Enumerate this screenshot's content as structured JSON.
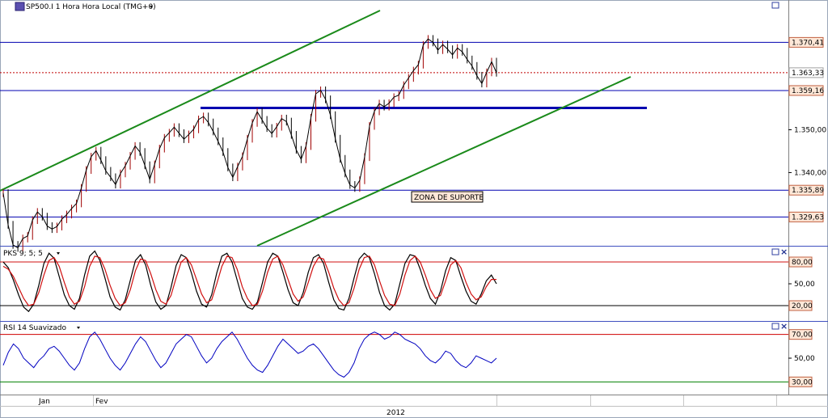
{
  "title": "SP500.I 1 Hora Hora Local (TMG+0)",
  "colors": {
    "price": "#000000",
    "candle_up": "#a00000",
    "hline": "#0000b0",
    "trend": "#1a8a1a",
    "dotted": "#c00000",
    "stoch_k": "#000000",
    "stoch_d": "#d01010",
    "rsi": "#0000c0",
    "rsi_upper": "#d00000",
    "rsi_lower": "#008000",
    "label_bg": "#ffe8d8",
    "label_border": "#c06040"
  },
  "icons": {
    "symbol": "chart-symbol-icon",
    "dropdown": "chevron-down-icon",
    "maximize": "maximize-icon",
    "close": "close-icon"
  },
  "chart_data": [
    {
      "type": "line",
      "panel": "price",
      "title": "SP500.I 1 Hora Hora Local (TMG+0)",
      "ylim": [
        1322.9,
        1380.3
      ],
      "y_ticks": [
        "1.340,00",
        "1.350,00"
      ],
      "price_series": [
        1335.2,
        1327.8,
        1323.1,
        1322.4,
        1324.6,
        1325.2,
        1328.9,
        1330.8,
        1329.7,
        1327.5,
        1326.8,
        1327.4,
        1329.1,
        1330.2,
        1331.6,
        1332.8,
        1336.4,
        1340.6,
        1343.7,
        1345.1,
        1342.9,
        1340.4,
        1338.9,
        1337.2,
        1339.8,
        1341.6,
        1343.9,
        1346.2,
        1344.8,
        1341.7,
        1338.4,
        1341.9,
        1345.6,
        1348.1,
        1349.3,
        1350.6,
        1349.2,
        1347.8,
        1348.9,
        1350.1,
        1352.4,
        1353.1,
        1351.7,
        1349.6,
        1347.3,
        1344.8,
        1341.2,
        1338.9,
        1341.4,
        1343.8,
        1347.9,
        1351.6,
        1354.2,
        1352.3,
        1350.4,
        1349.1,
        1350.7,
        1352.6,
        1351.9,
        1348.8,
        1345.3,
        1343.1,
        1346.2,
        1352.8,
        1358.4,
        1359.2,
        1357.1,
        1353.4,
        1347.9,
        1343.2,
        1339.8,
        1337.1,
        1336.4,
        1338.2,
        1343.6,
        1350.9,
        1354.3,
        1356.1,
        1355.4,
        1356.2,
        1357.6,
        1358.1,
        1360.4,
        1362.1,
        1363.8,
        1365.2,
        1369.8,
        1371.2,
        1370.4,
        1368.6,
        1369.9,
        1368.8,
        1367.5,
        1369.1,
        1368.2,
        1366.4,
        1364.9,
        1362.6,
        1360.8,
        1363.4,
        1365.9,
        1363.3
      ],
      "horizontal_lines": [
        {
          "value": 1370.41,
          "label": "1.370,41",
          "width": 1
        },
        {
          "value": 1359.16,
          "label": "1.359,16",
          "width": 1
        },
        {
          "value": 1335.89,
          "label": "1.335,89",
          "width": 1
        },
        {
          "value": 1329.63,
          "label": "1.329,63",
          "width": 1
        },
        {
          "value": 1355.1,
          "label": "",
          "width": 3,
          "x_range": [
            248,
            800
          ]
        }
      ],
      "current_value": {
        "value": 1363.33,
        "label": "1.363,33"
      },
      "annotation": "ZONA DE SUPORTE"
    },
    {
      "type": "line",
      "panel": "oscillator",
      "title": "PKS 9; 5; 5",
      "ylim": [
        0,
        100
      ],
      "levels": [
        {
          "value": 80,
          "label": "80,00"
        },
        {
          "value": 20,
          "label": "20,00"
        }
      ],
      "y_ticks": [
        "50,00"
      ],
      "series": [
        {
          "name": "%K",
          "values": [
            80,
            72,
            55,
            35,
            18,
            12,
            22,
            48,
            78,
            92,
            85,
            60,
            35,
            20,
            15,
            30,
            62,
            88,
            95,
            82,
            58,
            32,
            18,
            14,
            28,
            55,
            82,
            90,
            76,
            48,
            25,
            15,
            20,
            45,
            75,
            90,
            86,
            65,
            40,
            22,
            18,
            35,
            65,
            88,
            92,
            80,
            55,
            30,
            18,
            15,
            25,
            52,
            80,
            92,
            88,
            66,
            42,
            24,
            20,
            38,
            66,
            86,
            90,
            78,
            52,
            28,
            16,
            14,
            30,
            58,
            84,
            92,
            86,
            64,
            38,
            20,
            14,
            22,
            50,
            78,
            90,
            88,
            70,
            48,
            30,
            22,
            40,
            68,
            86,
            82,
            60,
            40,
            26,
            22,
            36,
            54,
            62,
            50
          ]
        },
        {
          "name": "%D",
          "values": [
            74,
            70,
            60,
            45,
            30,
            20,
            22,
            38,
            62,
            82,
            86,
            74,
            52,
            32,
            22,
            26,
            46,
            74,
            88,
            86,
            70,
            48,
            30,
            20,
            24,
            42,
            68,
            84,
            82,
            64,
            42,
            26,
            22,
            34,
            58,
            80,
            86,
            76,
            56,
            36,
            24,
            28,
            50,
            74,
            88,
            86,
            70,
            46,
            30,
            20,
            22,
            40,
            66,
            84,
            88,
            76,
            56,
            36,
            26,
            32,
            52,
            74,
            86,
            84,
            66,
            44,
            28,
            20,
            24,
            44,
            70,
            86,
            88,
            76,
            54,
            34,
            22,
            20,
            36,
            62,
            82,
            88,
            80,
            62,
            42,
            30,
            34,
            54,
            76,
            82,
            72,
            52,
            36,
            28,
            32,
            46,
            56,
            56
          ]
        }
      ]
    },
    {
      "type": "line",
      "panel": "oscillator",
      "title": "RSI 14 Suavizado",
      "ylim": [
        20,
        80
      ],
      "levels": [
        {
          "value": 70,
          "label": "70,00"
        },
        {
          "value": 30,
          "label": "30,00"
        }
      ],
      "y_ticks": [
        "50,00"
      ],
      "x_ticks": [
        "Jan",
        "Fev"
      ],
      "x_axis_label": "2012",
      "series": [
        {
          "name": "RSI",
          "values": [
            44,
            55,
            62,
            58,
            50,
            46,
            42,
            48,
            52,
            58,
            60,
            56,
            50,
            44,
            40,
            46,
            58,
            68,
            72,
            66,
            58,
            50,
            44,
            40,
            46,
            54,
            62,
            68,
            64,
            56,
            48,
            42,
            46,
            54,
            62,
            66,
            70,
            68,
            60,
            52,
            46,
            50,
            58,
            64,
            68,
            72,
            66,
            58,
            50,
            44,
            40,
            38,
            44,
            52,
            60,
            66,
            62,
            58,
            54,
            56,
            60,
            62,
            58,
            52,
            46,
            40,
            36,
            34,
            38,
            46,
            58,
            66,
            70,
            72,
            70,
            66,
            68,
            72,
            70,
            66,
            64,
            62,
            58,
            52,
            48,
            46,
            50,
            56,
            54,
            48,
            44,
            42,
            46,
            52,
            50,
            48,
            46,
            50
          ]
        }
      ]
    }
  ]
}
